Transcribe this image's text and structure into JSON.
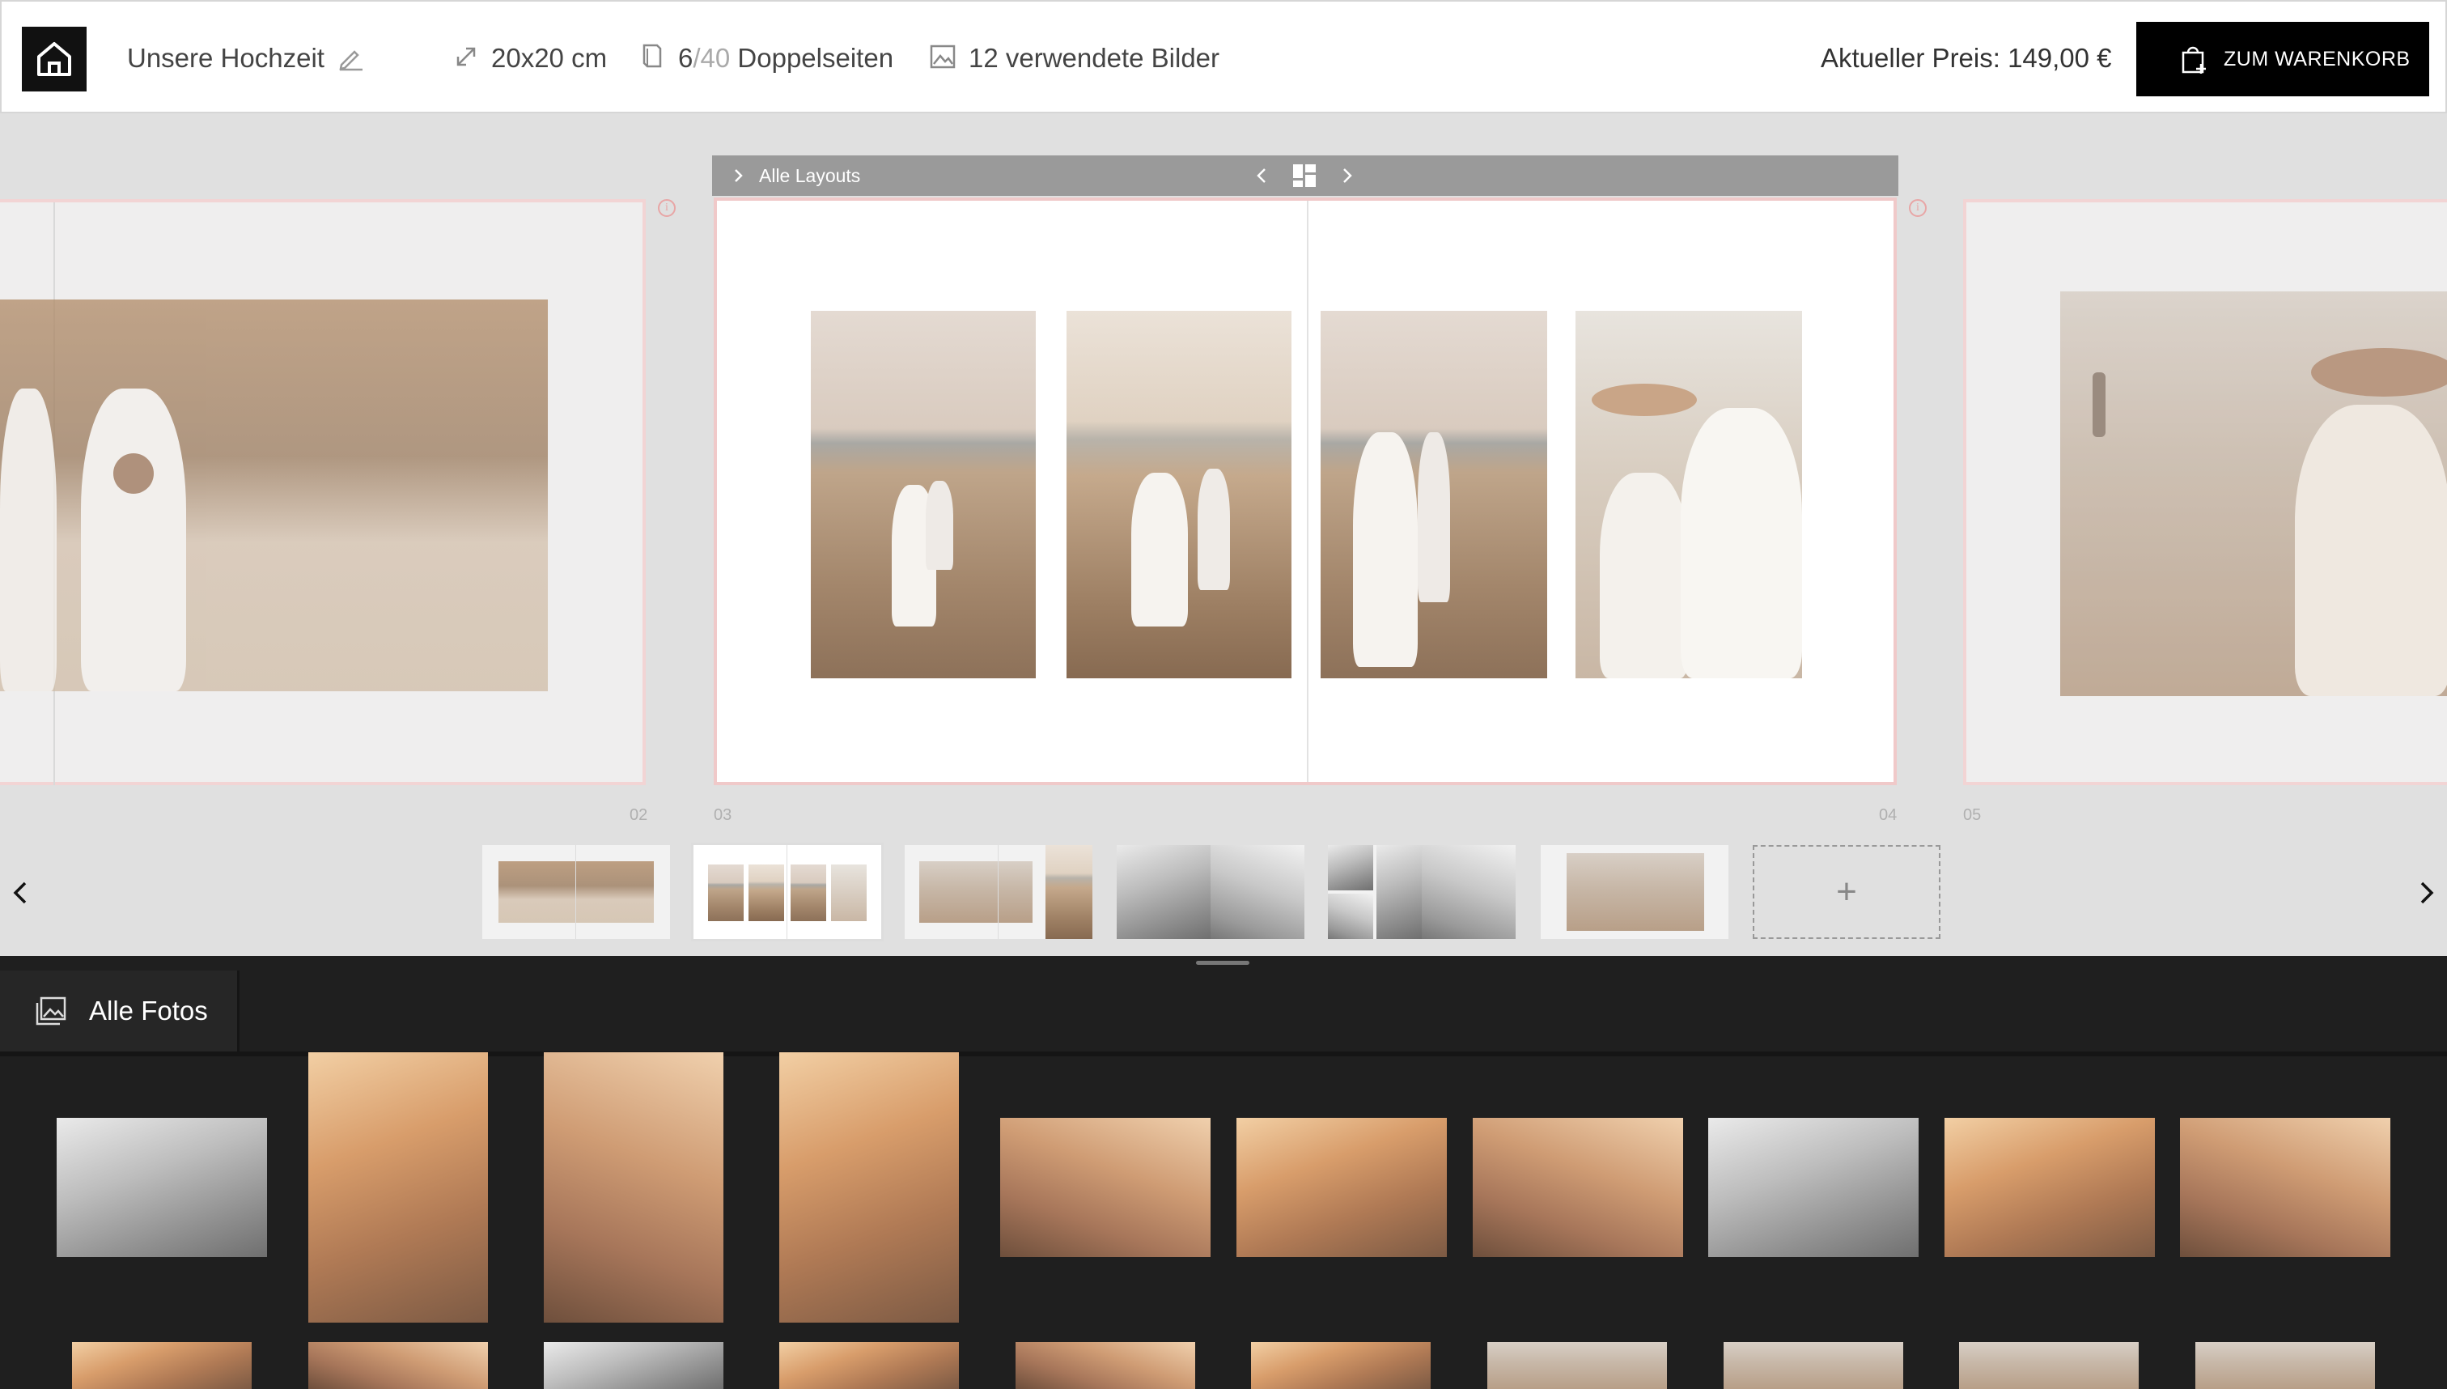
{
  "header": {
    "project_title": "Unsere Hochzeit",
    "format": "20x20 cm",
    "pages_current": "6",
    "pages_total": "/40",
    "pages_label": "Doppelseiten",
    "images_used": "12 verwendete Bilder",
    "price": "Aktueller Preis: 149,00 €",
    "cart_label": "ZUM WARENKORB"
  },
  "layout_bar": {
    "label": "Alle Layouts"
  },
  "page_numbers": {
    "left": "02",
    "current_left": "03",
    "current_right": "04",
    "right": "05"
  },
  "info_symbol": "i",
  "add_symbol": "+",
  "photos_panel": {
    "tab_label": "Alle Fotos"
  },
  "icons": [
    "home-icon",
    "pencil-icon",
    "resize-icon",
    "page-icon",
    "image-icon",
    "cart-icon",
    "chevron-left-icon",
    "chevron-right-icon",
    "layout-grid-icon",
    "plus-icon",
    "gallery-icon"
  ],
  "colors": {
    "accent_border": "#f0c9c9",
    "dark_panel": "#1f1f1f",
    "cart_bg": "#000000"
  }
}
